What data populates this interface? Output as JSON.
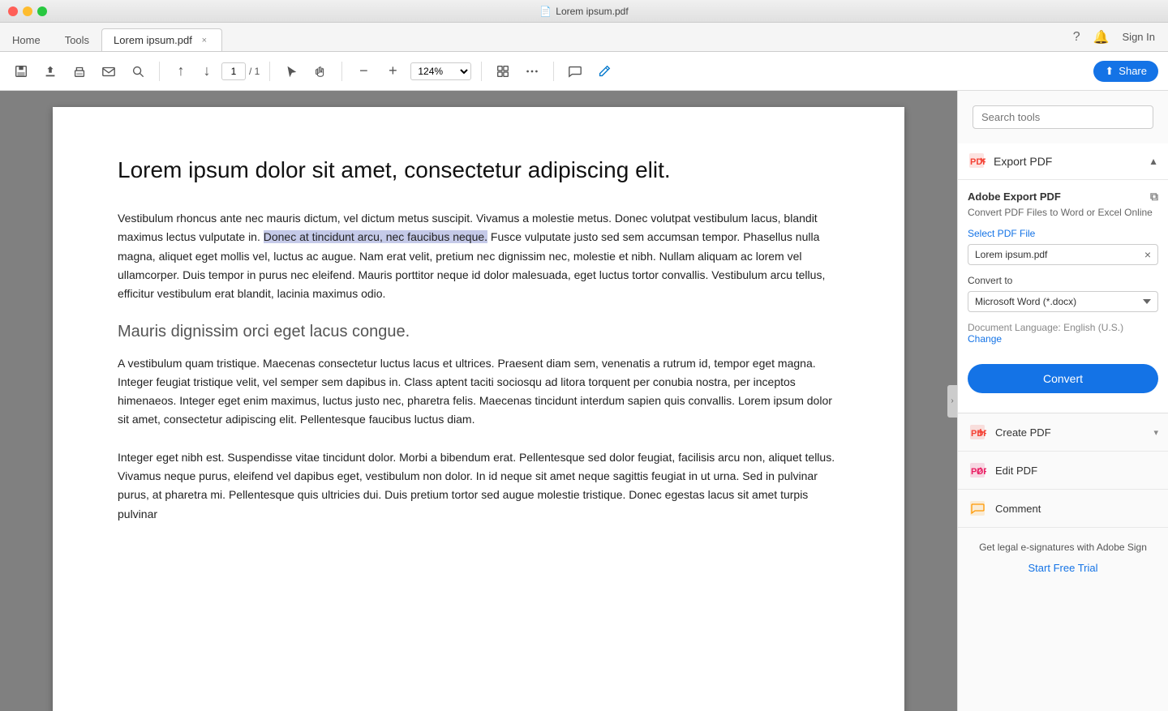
{
  "titlebar": {
    "title": "Lorem ipsum.pdf",
    "pdf_icon": "📄"
  },
  "tabs": {
    "home": "Home",
    "tools": "Tools",
    "active": "Lorem ipsum.pdf",
    "close_icon": "×"
  },
  "toolbar": {
    "save_icon": "💾",
    "upload_icon": "⬆",
    "print_icon": "🖨",
    "email_icon": "✉",
    "search_icon": "🔍",
    "prev_page": "↑",
    "next_page": "↓",
    "current_page": "1",
    "total_pages": "1",
    "cursor_icon": "↖",
    "hand_icon": "✋",
    "zoom_out_icon": "−",
    "zoom_in_icon": "+",
    "zoom_level": "124%",
    "fit_icon": "⊞",
    "more_icon": "⋯",
    "comment_icon": "💬",
    "pen_icon": "✏",
    "share_label": "Share",
    "share_icon": "⬆"
  },
  "pdf": {
    "title": "Lorem ipsum dolor sit amet, consectetur adipiscing elit.",
    "paragraph1": "Vestibulum rhoncus ante nec mauris dictum, vel dictum metus suscipit. Vivamus a molestie metus. Donec volutpat vestibulum lacus, blandit maximus lectus vulputate in. Donec at tincidunt arcu, nec faucibus neque. Fusce vulputate justo sed sem accumsan tempor. Phasellus nulla magna, aliquet eget mollis vel, luctus ac augue. Nam erat velit, pretium nec dignissim nec, molestie et nibh. Nullam aliquam ac lorem vel ullamcorper. Duis tempor in purus nec eleifend. Mauris porttitor neque id dolor malesuada, eget luctus tortor convallis. Vestibulum arcu tellus, efficitur vestibulum erat blandit, lacinia maximus odio.",
    "highlight_text": "Donec at tincidunt arcu, nec faucibus neque.",
    "heading2": "Mauris dignissim orci eget lacus congue.",
    "paragraph2": "A vestibulum quam tristique. Maecenas consectetur luctus lacus et ultrices. Praesent diam sem, venenatis a rutrum id, tempor eget magna. Integer feugiat tristique velit, vel semper sem dapibus in. Class aptent taciti sociosqu ad litora torquent per conubia nostra, per inceptos himenaeos. Integer eget enim maximus, luctus justo nec, pharetra felis. Maecenas tincidunt interdum sapien quis convallis. Lorem ipsum dolor sit amet, consectetur adipiscing elit. Pellentesque faucibus luctus diam.",
    "paragraph3": "Integer eget nibh est. Suspendisse vitae tincidunt dolor. Morbi a bibendum erat. Pellentesque sed dolor feugiat, facilisis arcu non, aliquet tellus. Vivamus neque purus, eleifend vel dapibus eget, vestibulum non dolor. In id neque sit amet neque sagittis feugiat in ut urna. Sed in pulvinar purus, at pharetra mi. Pellentesque quis ultricies dui. Duis pretium tortor sed augue molestie tristique. Donec egestas lacus sit amet turpis pulvinar"
  },
  "right_panel": {
    "search_placeholder": "Search tools",
    "export_pdf": {
      "section_title": "Export PDF",
      "adobe_export_title": "Adobe Export PDF",
      "copy_icon": "⧉",
      "description": "Convert PDF Files to Word or Excel Online",
      "select_pdf_label": "Select PDF File",
      "file_name": "Lorem ipsum.pdf",
      "convert_to_label": "Convert to",
      "convert_to_value": "Microsoft Word (*.docx)",
      "doc_language_label": "Document Language:",
      "doc_language_value": "English (U.S.)",
      "change_label": "Change",
      "convert_btn": "Convert"
    },
    "create_pdf": {
      "title": "Create PDF",
      "chevron": "▾"
    },
    "edit_pdf": {
      "title": "Edit PDF"
    },
    "comment": {
      "title": "Comment"
    },
    "bottom": {
      "text": "Get legal e-signatures with Adobe Sign",
      "trial_link": "Start Free Trial"
    }
  }
}
